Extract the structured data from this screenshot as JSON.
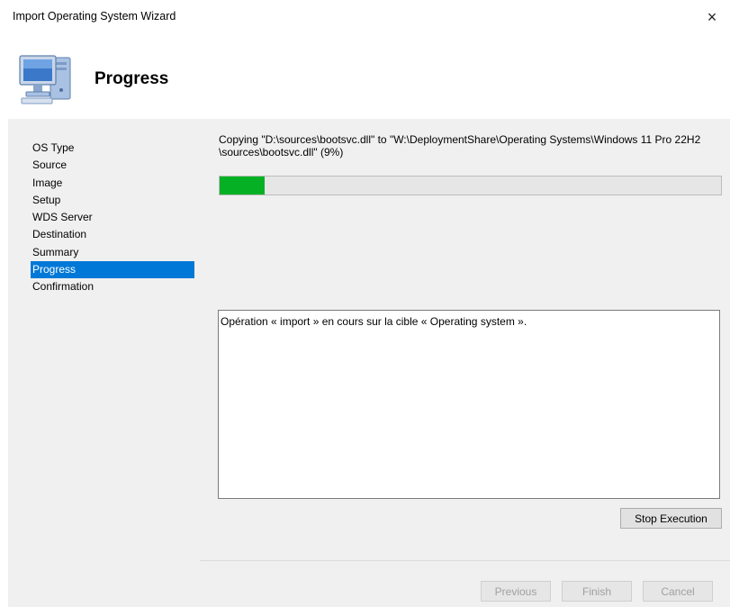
{
  "window": {
    "title": "Import Operating System Wizard",
    "close_glyph": "×"
  },
  "header": {
    "title": "Progress",
    "icon": "computer-icon"
  },
  "steps": [
    {
      "label": "OS Type",
      "active": false
    },
    {
      "label": "Source",
      "active": false
    },
    {
      "label": "Image",
      "active": false
    },
    {
      "label": "Setup",
      "active": false
    },
    {
      "label": "WDS Server",
      "active": false
    },
    {
      "label": "Destination",
      "active": false
    },
    {
      "label": "Summary",
      "active": false
    },
    {
      "label": "Progress",
      "active": true
    },
    {
      "label": "Confirmation",
      "active": false
    }
  ],
  "progress": {
    "status_text": "Copying \"D:\\sources\\bootsvc.dll\" to \"W:\\DeploymentShare\\Operating Systems\\Windows 11 Pro 22H2 \\sources\\bootsvc.dll\" (9%)",
    "percent": 9,
    "fill_color": "#06b025"
  },
  "log": {
    "text": "Opération « import » en cours sur la cible « Operating system »."
  },
  "buttons": {
    "stop_execution": "Stop Execution",
    "previous": "Previous",
    "finish": "Finish",
    "cancel": "Cancel"
  },
  "colors": {
    "selection": "#0078d7"
  }
}
